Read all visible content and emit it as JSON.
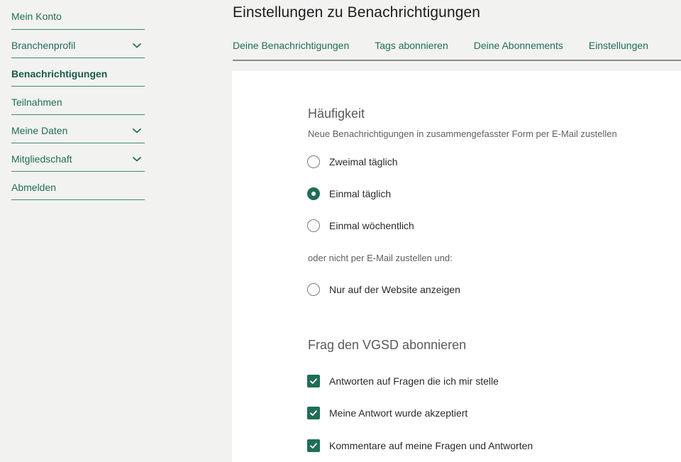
{
  "sidebar": {
    "items": [
      {
        "label": "Mein Konto"
      },
      {
        "label": "Branchenprofil"
      },
      {
        "label": "Benachrichtigungen"
      },
      {
        "label": "Teilnahmen"
      },
      {
        "label": "Meine Daten"
      },
      {
        "label": "Mitgliedschaft"
      },
      {
        "label": "Abmelden"
      }
    ]
  },
  "header": {
    "title": "Einstellungen zu Benachrichtigungen",
    "tabs": [
      {
        "label": "Deine Benachrichtigungen"
      },
      {
        "label": "Tags abonnieren"
      },
      {
        "label": "Deine Abonnements"
      },
      {
        "label": "Einstellungen"
      }
    ]
  },
  "frequency": {
    "title": "Häufigkeit",
    "description": "Neue Benachrichtigungen in zusammengefasster Form per E-Mail zustellen",
    "options": [
      {
        "label": "Zweimal täglich",
        "selected": false
      },
      {
        "label": "Einmal täglich",
        "selected": true
      },
      {
        "label": "Einmal wöchentlich",
        "selected": false
      }
    ],
    "alt_text": "oder nicht per E-Mail zustellen und:",
    "alt_option": {
      "label": "Nur auf der Website anzeigen",
      "selected": false
    }
  },
  "subscribe": {
    "title": "Frag den VGSD abonnieren",
    "options": [
      {
        "label": "Antworten auf Fragen die ich mir stelle",
        "checked": true
      },
      {
        "label": "Meine Antwort wurde akzeptiert",
        "checked": true
      },
      {
        "label": "Kommentare auf meine Fragen und Antworten",
        "checked": true
      }
    ]
  },
  "colors": {
    "accent": "#1e6f55",
    "background": "#f2f2f1",
    "card": "#ffffff"
  }
}
